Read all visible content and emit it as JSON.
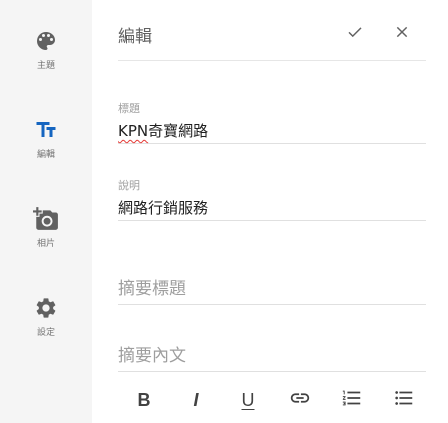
{
  "sidebar": {
    "items": [
      {
        "label": "主題",
        "icon": "palette-icon"
      },
      {
        "label": "編輯",
        "icon": "text-fields-icon"
      },
      {
        "label": "相片",
        "icon": "add-photo-icon"
      },
      {
        "label": "設定",
        "icon": "gear-icon"
      }
    ],
    "active_color": "#1565c0",
    "icon_color": "#616161"
  },
  "header": {
    "title": "編輯"
  },
  "form": {
    "title_label": "標題",
    "title_value_latin": "KPN",
    "title_value_rest": "奇寶網路",
    "description_label": "說明",
    "description_value": "網路行銷服務",
    "summary_title_placeholder": "摘要標題",
    "summary_content_placeholder": "摘要內文"
  },
  "toolbar": {
    "bold": "B",
    "italic": "I",
    "underline": "U"
  }
}
